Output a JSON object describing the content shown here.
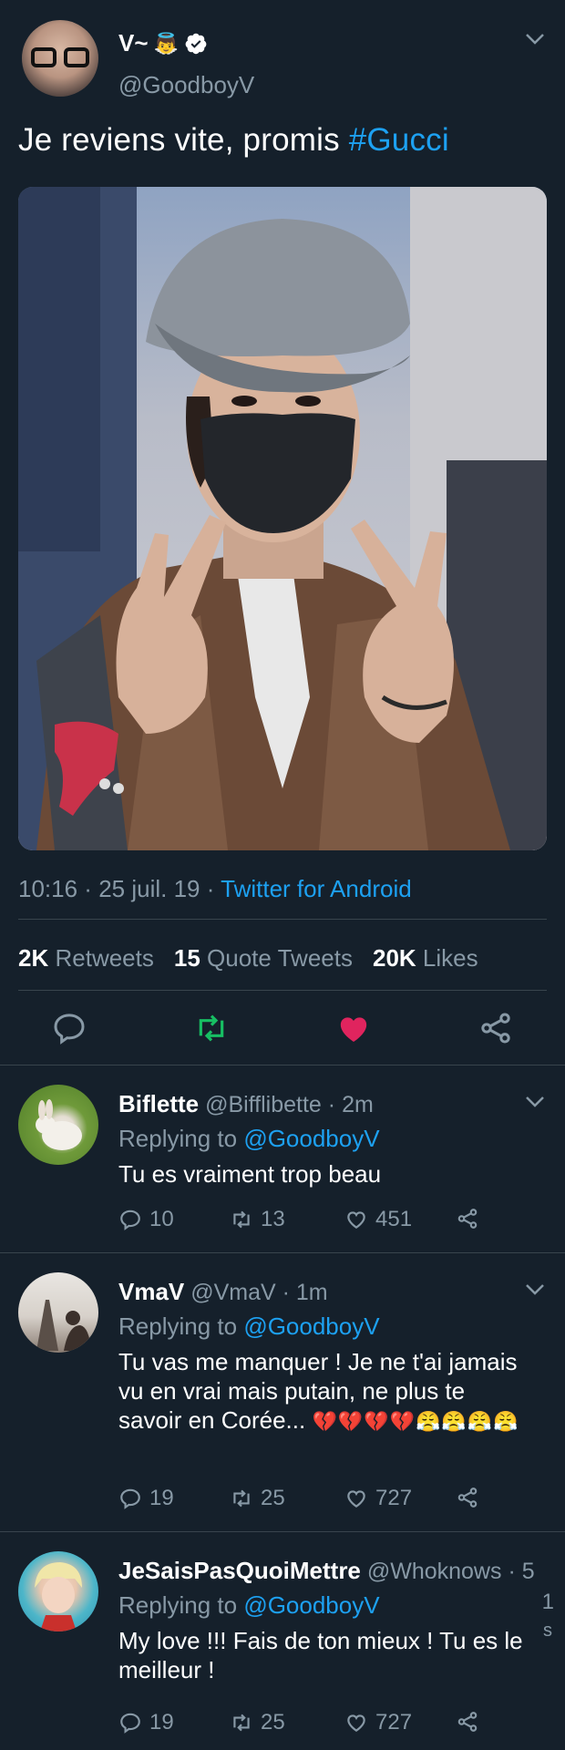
{
  "tweet": {
    "display_name": "V~",
    "name_emoji": "👼",
    "handle": "@GoodboyV",
    "text_main": "Je reviens vite, promis ",
    "hashtag": "#Gucci",
    "time": "10:16",
    "date": "25 juil. 19",
    "source": "Twitter for Android",
    "sep": " · ",
    "retweets_count": "2K",
    "retweets_label": "Retweets",
    "quotes_count": "15",
    "quotes_label": "Quote Tweets",
    "likes_count": "20K",
    "likes_label": "Likes"
  },
  "colors": {
    "background": "#15202b",
    "accent": "#1da1f2",
    "retweet": "#17bf63",
    "like": "#e0245e",
    "secondary": "#8899a6"
  },
  "replies": [
    {
      "name": "Biflette",
      "handle": "@Bifflibette",
      "time": "2m",
      "replying_label": "Replying to",
      "replying_handle": "@GoodboyV",
      "text": "Tu es vraiment trop beau",
      "replies": "10",
      "retweets": "13",
      "likes": "451"
    },
    {
      "name": "VmaV",
      "handle": "@VmaV",
      "time": "1m",
      "replying_label": "Replying to",
      "replying_handle": "@GoodboyV",
      "text_line1": "Tu vas me manquer ! Je ne t'ai jamais",
      "text_line2": "vu en vrai mais putain, ne plus te",
      "text_line3": "savoir en Corée...",
      "emojis": "💔💔💔💔😤😤😤😤",
      "replies": "19",
      "retweets": "25",
      "likes": "727"
    },
    {
      "name": "JeSaisPasQuoiMettre",
      "handle": "@Whoknows",
      "time_partial": "· 5",
      "side_digits": "1",
      "side_letter": "s",
      "replying_label": "Replying to",
      "replying_handle": "@GoodboyV",
      "text_line1": "My love !!! Fais de ton mieux ! Tu es le",
      "text_line2": "meilleur !",
      "replies": "19",
      "retweets": "25",
      "likes": "727"
    }
  ]
}
